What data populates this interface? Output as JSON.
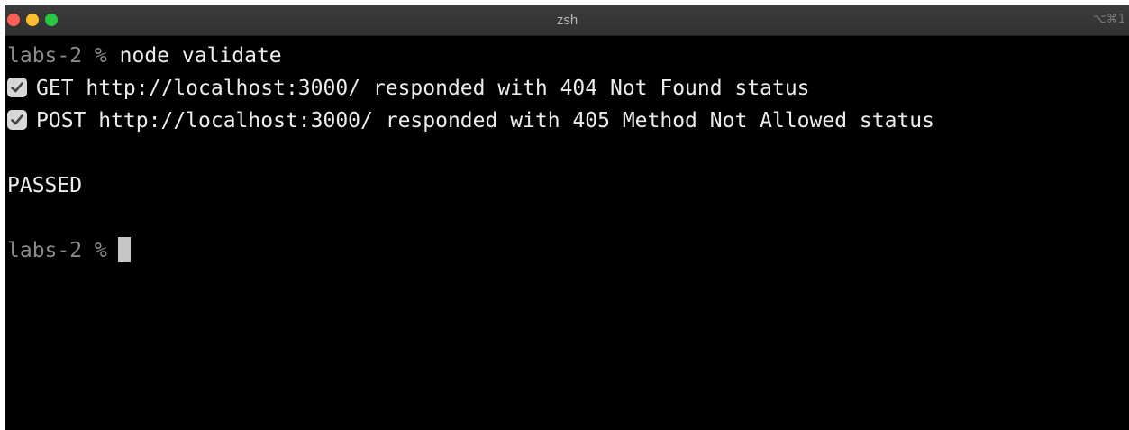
{
  "window": {
    "title": "zsh",
    "shortcut": "⌥⌘1"
  },
  "terminal": {
    "prompt": "labs-2 %",
    "command": "node validate",
    "results": [
      {
        "icon": "check-icon",
        "text": "GET http://localhost:3000/ responded with 404 Not Found status"
      },
      {
        "icon": "check-icon",
        "text": "POST http://localhost:3000/ responded with 405 Method Not Allowed status"
      }
    ],
    "status": "PASSED",
    "prompt2": "labs-2 %"
  },
  "colors": {
    "background": "#000000",
    "text": "#ececec",
    "prompt": "#8a8a8a",
    "close": "#fe5f57",
    "minimize": "#febc2e",
    "zoom": "#28c840"
  }
}
